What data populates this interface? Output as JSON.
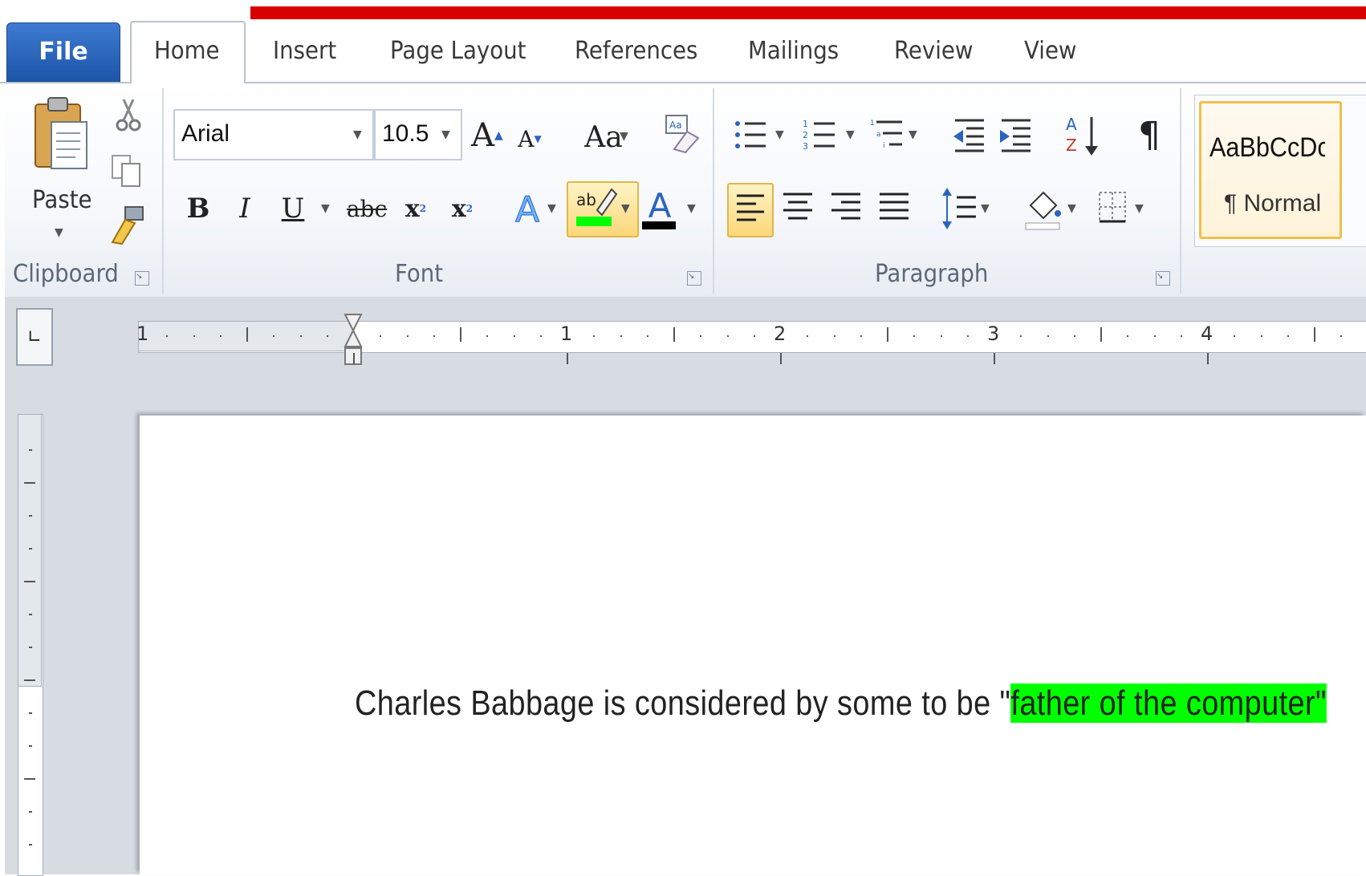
{
  "ribbon": {
    "tabs": [
      {
        "label": "File"
      },
      {
        "label": "Home"
      },
      {
        "label": "Insert"
      },
      {
        "label": "Page Layout"
      },
      {
        "label": "References"
      },
      {
        "label": "Mailings"
      },
      {
        "label": "Review"
      },
      {
        "label": "View"
      }
    ],
    "active_tab": "Home",
    "clipboard": {
      "group_label": "Clipboard",
      "paste_label": "Paste"
    },
    "font": {
      "group_label": "Font",
      "font_name": "Arial",
      "font_size": "10.5",
      "change_case_label": "Aa",
      "highlight_color": "#00ff00",
      "font_color": "#000000"
    },
    "paragraph": {
      "group_label": "Paragraph",
      "pilcrow": "¶"
    },
    "styles": {
      "preview": "AaBbCcDc",
      "normal_label": "¶ Normal"
    }
  },
  "ruler": {
    "numbers": [
      "1",
      "2",
      "3",
      "4"
    ]
  },
  "document": {
    "text_before": "Charles  Babbage  is  considered  by some  to  be  \"",
    "highlighted": "father of the computer\"",
    "highlight_color": "#00ff00"
  },
  "colors": {
    "accent_file_tab": "#2a64bd",
    "top_bar": "#d90000",
    "selected_button": "#fcd779"
  }
}
